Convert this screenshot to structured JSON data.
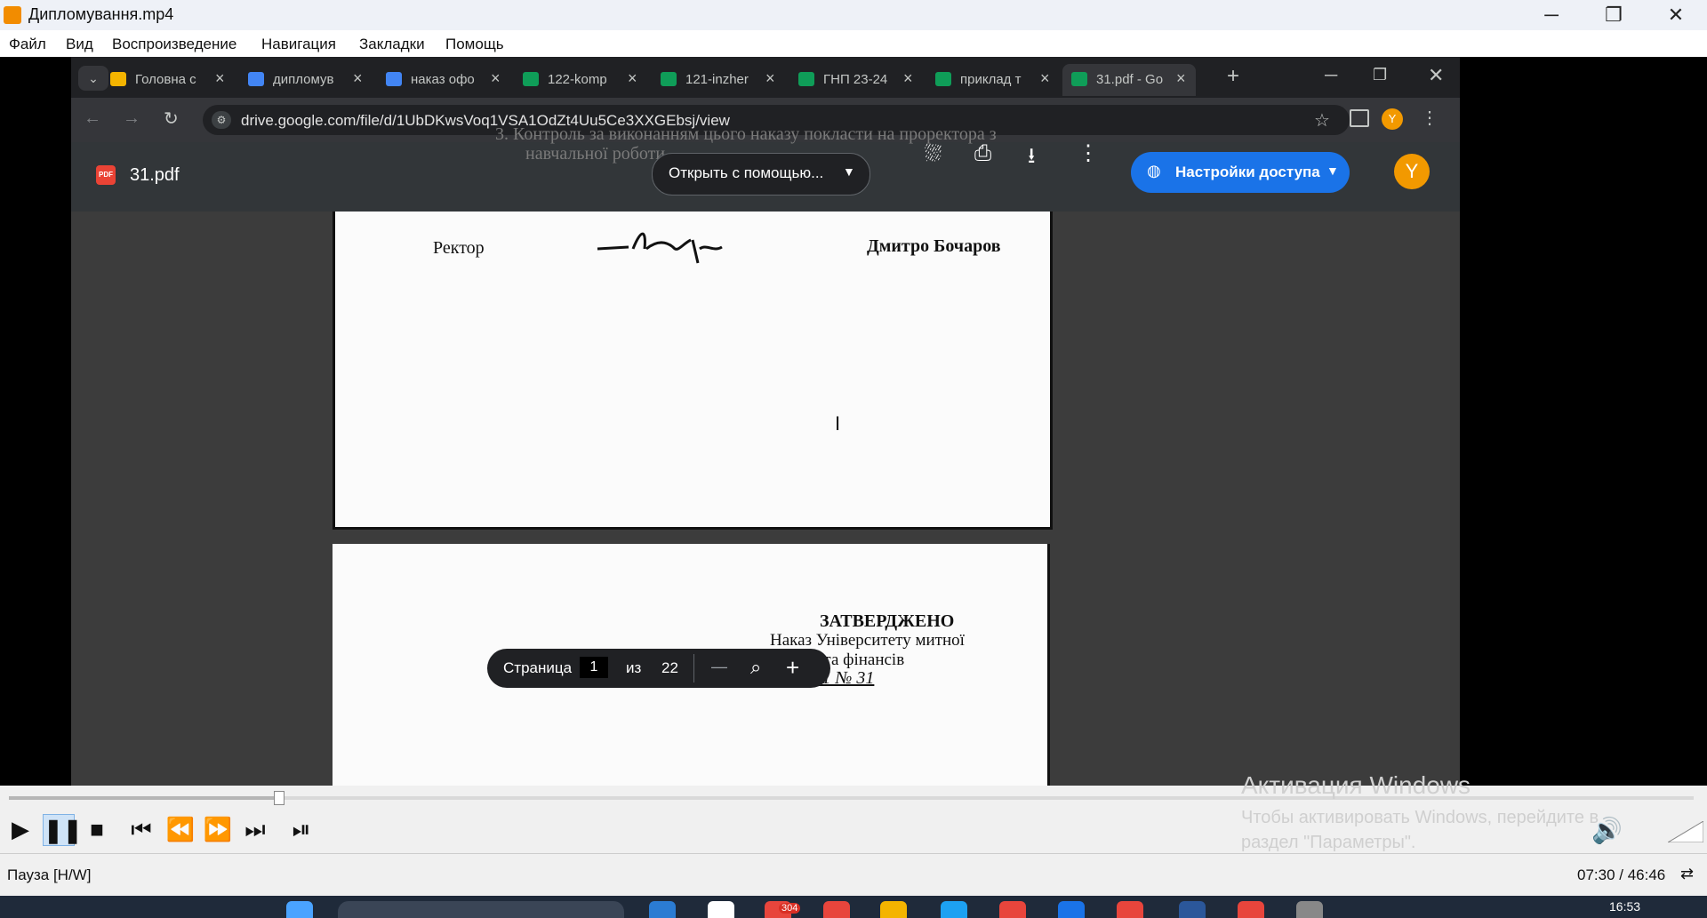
{
  "window": {
    "title": "Дипломування.mp4",
    "minimize": "─",
    "maximize": "❐",
    "close": "✕"
  },
  "menu": [
    "Файл",
    "Вид",
    "Воспроизведение",
    "Навигация",
    "Закладки",
    "Помощь"
  ],
  "browser": {
    "tabs": [
      {
        "label": "Головна с",
        "color": "#f4b400"
      },
      {
        "label": "дипломув",
        "color": "#4285f4"
      },
      {
        "label": "наказ офо",
        "color": "#4285f4"
      },
      {
        "label": "122-komp",
        "color": "#0f9d58"
      },
      {
        "label": "121-inzher",
        "color": "#0f9d58"
      },
      {
        "label": "ГНП 23-24",
        "color": "#0f9d58"
      },
      {
        "label": "приклад т",
        "color": "#0f9d58"
      },
      {
        "label": "31.pdf - Go",
        "color": "#0f9d58",
        "active": true
      }
    ],
    "new_tab": "+",
    "url": "drive.google.com/file/d/1UbDKwsVoq1VSA1OdZt4Uu5Ce3XXGEbsj/view",
    "profile_initial": "Y"
  },
  "pdf": {
    "file_name": "31.pdf",
    "file_badge": "PDF",
    "open_with": "Открыть с помощью...",
    "share": "Настройки доступа",
    "avatar": "Y",
    "page_label": "Страница",
    "page_current": "1",
    "page_of": "из",
    "page_total": "22",
    "zoom_out": "—",
    "zoom_in": "+",
    "doc_text_top_1": "3.   Контроль за виконанням цього наказу покласти на проректора з",
    "doc_text_top_2": "навчальної роботи",
    "rector": "Ректор",
    "signer": "Дмитро Бочаров",
    "approved": "ЗАТВЕРДЖЕНО",
    "order_line1": "Наказ Університету митної",
    "order_line2": "справи та фінансів",
    "order_line3": "31.01.11  № 31"
  },
  "vlc": {
    "status": "Пауза [H/W]",
    "time": "07:30 / 46:46",
    "progress": 0.16,
    "activation_title": "Активация Windows",
    "activation_text": "Чтобы активировать Windows, перейдите в раздел \"Параметры\".",
    "clock": "16:53",
    "badge": "304"
  }
}
